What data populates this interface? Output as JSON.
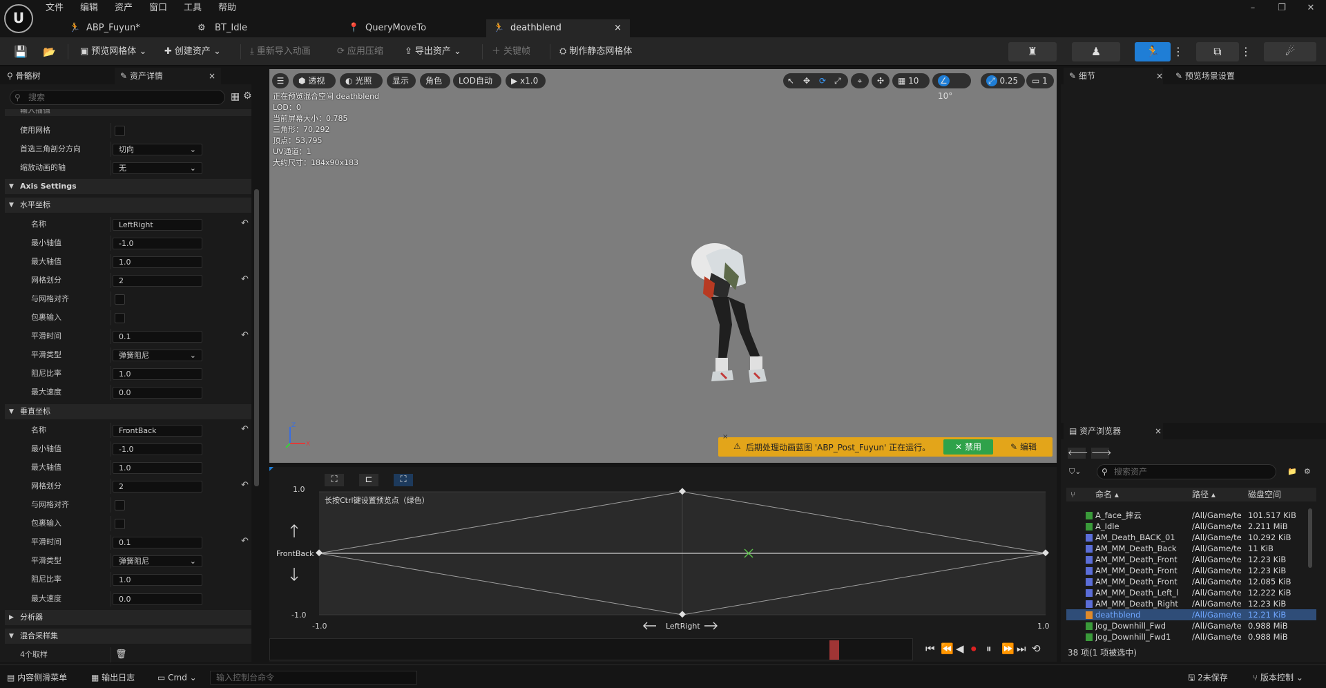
{
  "menu": [
    "文件",
    "编辑",
    "资产",
    "窗口",
    "工具",
    "帮助"
  ],
  "tabs": [
    {
      "label": "ABP_Fuyun*",
      "icon": "🏃"
    },
    {
      "label": "BT_Idle",
      "icon": "⚙"
    },
    {
      "label": "QueryMoveTo",
      "icon": "📍"
    },
    {
      "label": "deathblend",
      "icon": "🏃"
    }
  ],
  "tab_close": "×",
  "window_controls": [
    "–",
    "❐",
    "✕"
  ],
  "toolbar": {
    "preview_mesh": "预览网格体",
    "create_asset": "创建资产",
    "reimport": "重新导入动画",
    "apply_compression": "应用压缩",
    "export_asset": "导出资产",
    "keyframe": "关键帧",
    "make_static_mesh": "制作静态网格体"
  },
  "left_panel": {
    "tab_skeleton": "骨骼树",
    "tab_details": "资产详情",
    "search_placeholder": "搜索",
    "top_cut": "输入插值",
    "rows": [
      {
        "label": "使用网格",
        "type": "check",
        "indent": 1
      },
      {
        "label": "首选三角剖分方向",
        "type": "dd",
        "value": "切向",
        "indent": 1
      },
      {
        "label": "缩放动画的轴",
        "type": "dd",
        "value": "无",
        "indent": 1
      },
      {
        "label": "Axis Settings",
        "type": "section",
        "indent": 0
      },
      {
        "label": "水平坐标",
        "type": "subsection",
        "indent": 0
      },
      {
        "label": "名称",
        "type": "text",
        "value": "LeftRight",
        "indent": 2,
        "reset": true
      },
      {
        "label": "最小轴值",
        "type": "text",
        "value": "-1.0",
        "indent": 2
      },
      {
        "label": "最大轴值",
        "type": "text",
        "value": "1.0",
        "indent": 2
      },
      {
        "label": "网格划分",
        "type": "text",
        "value": "2",
        "indent": 2,
        "reset": true
      },
      {
        "label": "与网格对齐",
        "type": "check",
        "indent": 2
      },
      {
        "label": "包裹输入",
        "type": "check",
        "indent": 2
      },
      {
        "label": "平滑时间",
        "type": "text",
        "value": "0.1",
        "indent": 2,
        "reset": true
      },
      {
        "label": "平滑类型",
        "type": "dd",
        "value": "弹簧阻尼",
        "indent": 2
      },
      {
        "label": "阻尼比率",
        "type": "text",
        "value": "1.0",
        "indent": 2
      },
      {
        "label": "最大速度",
        "type": "text",
        "value": "0.0",
        "indent": 2
      },
      {
        "label": "垂直坐标",
        "type": "subsection",
        "indent": 0
      },
      {
        "label": "名称",
        "type": "text",
        "value": "FrontBack",
        "indent": 2,
        "reset": true
      },
      {
        "label": "最小轴值",
        "type": "text",
        "value": "-1.0",
        "indent": 2
      },
      {
        "label": "最大轴值",
        "type": "text",
        "value": "1.0",
        "indent": 2
      },
      {
        "label": "网格划分",
        "type": "text",
        "value": "2",
        "indent": 2,
        "reset": true
      },
      {
        "label": "与网格对齐",
        "type": "check",
        "indent": 2
      },
      {
        "label": "包裹输入",
        "type": "check",
        "indent": 2
      },
      {
        "label": "平滑时间",
        "type": "text",
        "value": "0.1",
        "indent": 2,
        "reset": true
      },
      {
        "label": "平滑类型",
        "type": "dd",
        "value": "弹簧阻尼",
        "indent": 2
      },
      {
        "label": "阻尼比率",
        "type": "text",
        "value": "1.0",
        "indent": 2
      },
      {
        "label": "最大速度",
        "type": "text",
        "value": "0.0",
        "indent": 2
      },
      {
        "label": "分析器",
        "type": "collapsed",
        "indent": 0
      },
      {
        "label": "混合采样集",
        "type": "subsection",
        "indent": 0
      },
      {
        "label": "4个取样",
        "type": "trash",
        "indent": 1
      }
    ]
  },
  "viewport": {
    "buttons": [
      "透视",
      "光照",
      "显示",
      "角色",
      "LOD自动",
      "x1.0"
    ],
    "info": [
      "正在预览混合空间 deathblend",
      "LOD：0",
      "当前屏幕大小：0.785",
      "三角形：70,292",
      "顶点：53,795",
      "UV通道：1",
      "大约尺寸：184x90x183"
    ],
    "grid_snap": "10",
    "rot_snap": "10°",
    "scale_snap": "0.25",
    "camera_speed": "1",
    "warning": "后期处理动画蓝图 'ABP_Post_Fuyun' 正在运行。",
    "disable_label": "禁用",
    "edit_label": "编辑"
  },
  "blendspace": {
    "hint": "长按Ctrl键设置预览点（绿色）",
    "y_axis": "FrontBack",
    "x_axis": "LeftRight",
    "y_max": "1.0",
    "y_min": "-1.0",
    "x_min": "-1.0",
    "x_max": "1.0"
  },
  "right_panel": {
    "tab_details": "细节",
    "tab_preview": "预览场景设置"
  },
  "asset_browser": {
    "title": "资产浏览器",
    "search_placeholder": "搜索资产",
    "col_name": "命名",
    "col_path": "路径",
    "col_size": "磁盘空间",
    "rows": [
      {
        "name": "A_face_摔云",
        "path": "/All/Game/te",
        "size": "101.517 KiB",
        "color": "#3a9a3a"
      },
      {
        "name": "A_Idle",
        "path": "/All/Game/te",
        "size": "2.211 MiB",
        "color": "#3a9a3a"
      },
      {
        "name": "AM_Death_BACK_01",
        "path": "/All/Game/te",
        "size": "10.292 KiB",
        "color": "#5b6ed8"
      },
      {
        "name": "AM_MM_Death_Back",
        "path": "/All/Game/te",
        "size": "11 KiB",
        "color": "#5b6ed8"
      },
      {
        "name": "AM_MM_Death_Front",
        "path": "/All/Game/te",
        "size": "12.23 KiB",
        "color": "#5b6ed8"
      },
      {
        "name": "AM_MM_Death_Front",
        "path": "/All/Game/te",
        "size": "12.23 KiB",
        "color": "#5b6ed8"
      },
      {
        "name": "AM_MM_Death_Front",
        "path": "/All/Game/te",
        "size": "12.085 KiB",
        "color": "#5b6ed8"
      },
      {
        "name": "AM_MM_Death_Left_l",
        "path": "/All/Game/te",
        "size": "12.222 KiB",
        "color": "#5b6ed8"
      },
      {
        "name": "AM_MM_Death_Right",
        "path": "/All/Game/te",
        "size": "12.23 KiB",
        "color": "#5b6ed8"
      },
      {
        "name": "deathblend",
        "path": "/All/Game/te",
        "size": "12.21 KiB",
        "color": "#e08a2a",
        "selected": true
      },
      {
        "name": "Jog_Downhill_Fwd",
        "path": "/All/Game/te",
        "size": "0.988 MiB",
        "color": "#3a9a3a"
      },
      {
        "name": "Jog_Downhill_Fwd1",
        "path": "/All/Game/te",
        "size": "0.988 MiB",
        "color": "#3a9a3a"
      }
    ],
    "count": "38 项(1 项被选中)"
  },
  "statusbar": {
    "content_drawer": "内容侧滑菜单",
    "output_log": "输出日志",
    "cmd": "Cmd",
    "cmd_placeholder": "输入控制台命令",
    "unsaved": "2未保存",
    "source_control": "版本控制"
  }
}
